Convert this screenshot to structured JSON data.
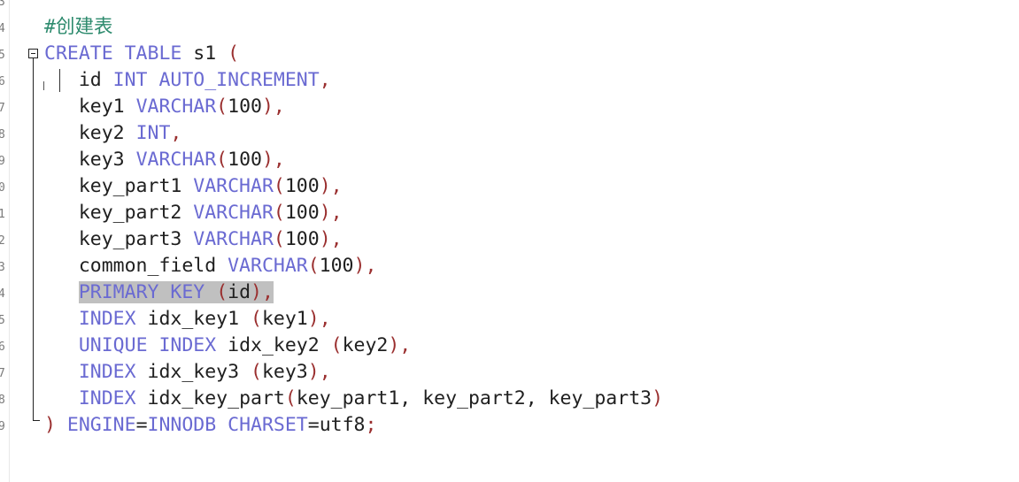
{
  "editor": {
    "line_numbers": [
      "3",
      "4",
      "5",
      "6",
      "7",
      "8",
      "9",
      "0",
      "1",
      "2",
      "3",
      "4",
      "5",
      "6",
      "7",
      "8",
      "9"
    ],
    "lines": [
      [
        {
          "t": "cm",
          "v": "#创建表"
        }
      ],
      [
        {
          "t": "kw",
          "v": "CREATE TABLE "
        },
        {
          "t": "tx",
          "v": "s1 "
        },
        {
          "t": "pn",
          "v": "("
        }
      ],
      [
        {
          "t": "tx",
          "v": "   id "
        },
        {
          "t": "kw",
          "v": "INT AUTO_INCREMENT"
        },
        {
          "t": "pn",
          "v": ","
        }
      ],
      [
        {
          "t": "tx",
          "v": "   key1 "
        },
        {
          "t": "kw",
          "v": "VARCHAR"
        },
        {
          "t": "pn",
          "v": "("
        },
        {
          "t": "tx",
          "v": "100"
        },
        {
          "t": "pn",
          "v": "),"
        }
      ],
      [
        {
          "t": "tx",
          "v": "   key2 "
        },
        {
          "t": "kw",
          "v": "INT"
        },
        {
          "t": "pn",
          "v": ","
        }
      ],
      [
        {
          "t": "tx",
          "v": "   key3 "
        },
        {
          "t": "kw",
          "v": "VARCHAR"
        },
        {
          "t": "pn",
          "v": "("
        },
        {
          "t": "tx",
          "v": "100"
        },
        {
          "t": "pn",
          "v": "),"
        }
      ],
      [
        {
          "t": "tx",
          "v": "   key_part1 "
        },
        {
          "t": "kw",
          "v": "VARCHAR"
        },
        {
          "t": "pn",
          "v": "("
        },
        {
          "t": "tx",
          "v": "100"
        },
        {
          "t": "pn",
          "v": "),"
        }
      ],
      [
        {
          "t": "tx",
          "v": "   key_part2 "
        },
        {
          "t": "kw",
          "v": "VARCHAR"
        },
        {
          "t": "pn",
          "v": "("
        },
        {
          "t": "tx",
          "v": "100"
        },
        {
          "t": "pn",
          "v": "),"
        }
      ],
      [
        {
          "t": "tx",
          "v": "   key_part3 "
        },
        {
          "t": "kw",
          "v": "VARCHAR"
        },
        {
          "t": "pn",
          "v": "("
        },
        {
          "t": "tx",
          "v": "100"
        },
        {
          "t": "pn",
          "v": "),"
        }
      ],
      [
        {
          "t": "tx",
          "v": "   common_field "
        },
        {
          "t": "kw",
          "v": "VARCHAR"
        },
        {
          "t": "pn",
          "v": "("
        },
        {
          "t": "tx",
          "v": "100"
        },
        {
          "t": "pn",
          "v": "),"
        }
      ],
      [
        {
          "t": "tx",
          "v": "   "
        },
        {
          "t": "kw sel",
          "v": "PRIMARY KEY "
        },
        {
          "t": "pn sel",
          "v": "("
        },
        {
          "t": "tx sel",
          "v": "id"
        },
        {
          "t": "pn sel",
          "v": "),"
        }
      ],
      [
        {
          "t": "tx",
          "v": "   "
        },
        {
          "t": "kw",
          "v": "INDEX "
        },
        {
          "t": "tx",
          "v": "idx_key1 "
        },
        {
          "t": "pn",
          "v": "("
        },
        {
          "t": "tx",
          "v": "key1"
        },
        {
          "t": "pn",
          "v": "),"
        }
      ],
      [
        {
          "t": "tx",
          "v": "   "
        },
        {
          "t": "kw",
          "v": "UNIQUE INDEX "
        },
        {
          "t": "tx",
          "v": "idx_key2 "
        },
        {
          "t": "pn",
          "v": "("
        },
        {
          "t": "tx",
          "v": "key2"
        },
        {
          "t": "pn",
          "v": "),"
        }
      ],
      [
        {
          "t": "tx",
          "v": "   "
        },
        {
          "t": "kw",
          "v": "INDEX "
        },
        {
          "t": "tx",
          "v": "idx_key3 "
        },
        {
          "t": "pn",
          "v": "("
        },
        {
          "t": "tx",
          "v": "key3"
        },
        {
          "t": "pn",
          "v": "),"
        }
      ],
      [
        {
          "t": "tx",
          "v": "   "
        },
        {
          "t": "kw",
          "v": "INDEX "
        },
        {
          "t": "tx",
          "v": "idx_key_part"
        },
        {
          "t": "pn",
          "v": "("
        },
        {
          "t": "tx",
          "v": "key_part1, key_part2, key_part3"
        },
        {
          "t": "pn",
          "v": ")"
        }
      ],
      [
        {
          "t": "pn",
          "v": ") "
        },
        {
          "t": "kw",
          "v": "ENGINE"
        },
        {
          "t": "tx",
          "v": "="
        },
        {
          "t": "kw",
          "v": "INNODB CHARSET"
        },
        {
          "t": "tx",
          "v": "="
        },
        {
          "t": "tx",
          "v": "utf8"
        },
        {
          "t": "pn",
          "v": ";"
        }
      ]
    ]
  },
  "colors": {
    "comment": "#2e8b6e",
    "keyword": "#6a6ad2",
    "punctuation": "#9a2f2f",
    "text": "#202020",
    "selection": "#c0c0c0"
  }
}
